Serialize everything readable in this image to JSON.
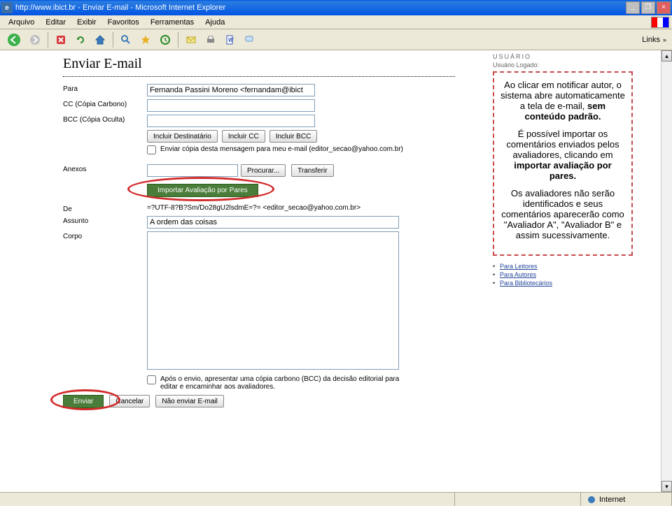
{
  "window": {
    "title": "http://www.ibict.br - Enviar E-mail - Microsoft Internet Explorer"
  },
  "menu": {
    "items": [
      "Arquivo",
      "Editar",
      "Exibir",
      "Favoritos",
      "Ferramentas",
      "Ajuda"
    ]
  },
  "links_label": "Links",
  "page": {
    "title": "Enviar E-mail",
    "labels": {
      "para": "Para",
      "cc": "CC (Cópia Carbono)",
      "bcc": "BCC (Cópia Oculta)",
      "anexos": "Anexos",
      "de": "De",
      "assunto": "Assunto",
      "corpo": "Corpo"
    },
    "values": {
      "para": "Fernanda Passini Moreno <fernandam@ibict",
      "de": "=?UTF-8?B?Sm/Do28gU2lsdmE=?= <editor_secao@yahoo.com.br>",
      "assunto": "A ordem das coisas"
    },
    "buttons": {
      "incluir_dest": "Incluir Destinatário",
      "incluir_cc": "Incluir CC",
      "incluir_bcc": "Incluir BCC",
      "procurar": "Procurar...",
      "transferir": "Transferir",
      "importar": "Importar Avaliação por Pares",
      "enviar": "Enviar",
      "cancelar": "Cancelar",
      "nao_enviar": "Não enviar E-mail"
    },
    "checkboxes": {
      "enviar_copia": "Enviar cópia desta mensagem para meu e-mail (editor_secao@yahoo.com.br)",
      "apos_envio": "Após o envio, apresentar uma cópia carbono (BCC) da decisão editorial para editar e encaminhar aos avaliadores."
    }
  },
  "sidebar": {
    "heading": "USUÁRIO",
    "sub": "Usuário Logado:",
    "annotation": {
      "p1_a": "Ao clicar em notificar autor, o sistema abre automaticamente a tela de e-mail, ",
      "p1_b": "sem conteúdo padrão.",
      "p2_a": "É possível importar os comentários enviados pelos avaliadores, clicando em ",
      "p2_b": "importar avaliação por pares.",
      "p3": "Os avaliadores não serão identificados e seus comentários aparecerão como \"Avaliador A\", \"Avaliador B\" e assim sucessivamente."
    },
    "links": [
      "Para Leitores",
      "Para Autores",
      "Para Bibliotecários"
    ]
  },
  "status": {
    "zone": "Internet"
  }
}
